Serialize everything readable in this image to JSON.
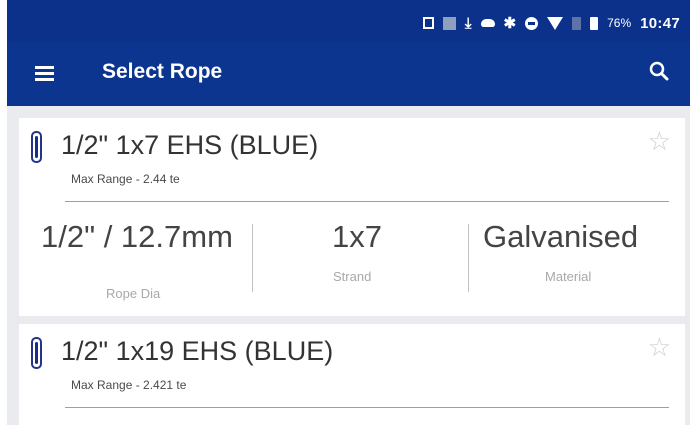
{
  "status_bar": {
    "battery": "76%",
    "time": "10:47"
  },
  "app_bar": {
    "title": "Select Rope",
    "menu_icon": "hamburger-menu-icon",
    "search_icon": "search-icon"
  },
  "ropes": [
    {
      "title": "1/2\" 1x7 EHS (BLUE)",
      "max_range": "Max Range - 2.44 te",
      "specs": [
        {
          "value": "1/2\" / 12.7mm",
          "label": "Rope Dia"
        },
        {
          "value": "1x7",
          "label": "Strand"
        },
        {
          "value": "Galvanised",
          "label": "Material"
        }
      ]
    },
    {
      "title": "1/2\" 1x19 EHS (BLUE)",
      "max_range": "Max Range - 2.421 te"
    }
  ],
  "colors": {
    "primary": "#0c3590",
    "status_bar": "#0c318a",
    "background": "#e9ebee",
    "rope_indicator": "#1a2c86"
  }
}
